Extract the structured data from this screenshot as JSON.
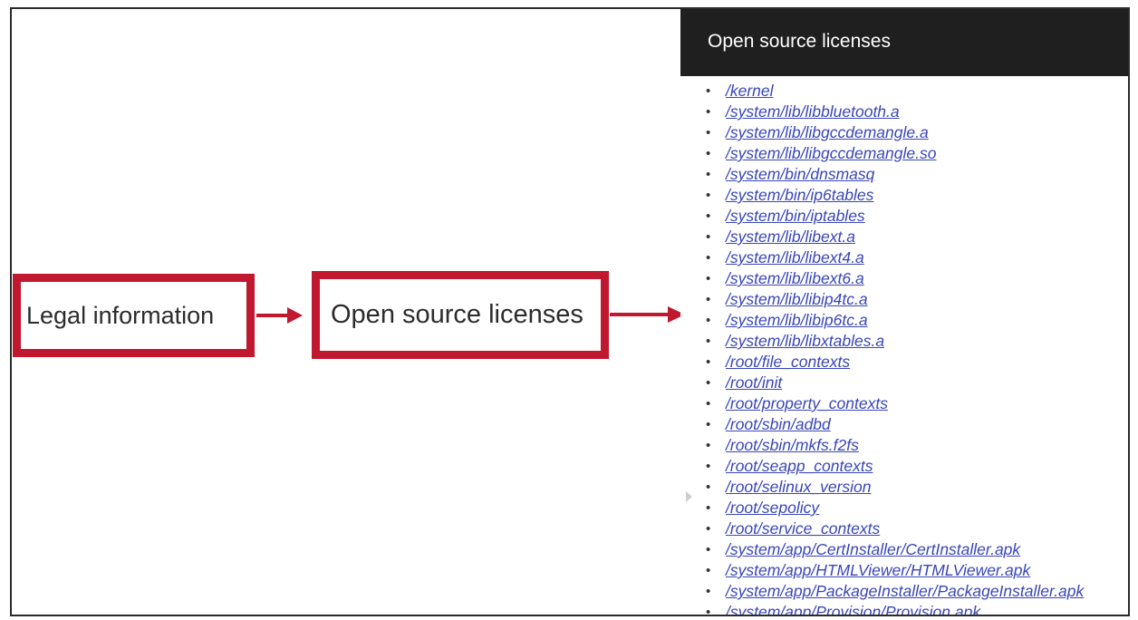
{
  "steps": {
    "legal_information": "Legal information",
    "open_source_licenses": "Open source licenses"
  },
  "panel": {
    "title": "Open source licenses",
    "licenses": [
      "/kernel",
      "/system/lib/libbluetooth.a",
      "/system/lib/libgccdemangle.a",
      "/system/lib/libgccdemangle.so",
      "/system/bin/dnsmasq",
      "/system/bin/ip6tables",
      "/system/bin/iptables",
      "/system/lib/libext.a",
      "/system/lib/libext4.a",
      "/system/lib/libext6.a",
      "/system/lib/libip4tc.a",
      "/system/lib/libip6tc.a",
      "/system/lib/libxtables.a",
      "/root/file_contexts",
      "/root/init",
      "/root/property_contexts",
      "/root/sbin/adbd",
      "/root/sbin/mkfs.f2fs",
      "/root/seapp_contexts",
      "/root/selinux_version",
      "/root/sepolicy",
      "/root/service_contexts",
      "/system/app/CertInstaller/CertInstaller.apk",
      "/system/app/HTMLViewer/HTMLViewer.apk",
      "/system/app/PackageInstaller/PackageInstaller.apk",
      "/system/app/Provision/Provision.apk"
    ]
  },
  "icons": {
    "step_arrow": "right-arrow-icon",
    "list_bullet": "bullet-icon",
    "collapse_marker": "triangle-right-icon"
  },
  "colors": {
    "highlight_border": "#c0182f",
    "arrow": "#c0182f",
    "header_background": "#1f1f1f",
    "header_text": "#ffffff",
    "link": "#3a46b8"
  }
}
